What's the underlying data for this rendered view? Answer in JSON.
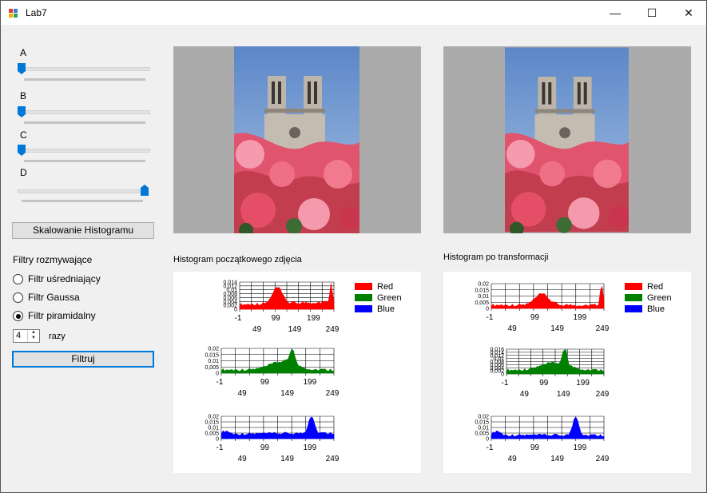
{
  "window": {
    "title": "Lab7",
    "minimize_glyph": "—",
    "maximize_glyph": "☐",
    "close_glyph": "✕"
  },
  "sliders": [
    {
      "label": "A",
      "value_fraction": 0.0
    },
    {
      "label": "B",
      "value_fraction": 0.0
    },
    {
      "label": "C",
      "value_fraction": 0.0
    },
    {
      "label": "D",
      "value_fraction": 1.0
    }
  ],
  "scale_button": "Skalowanie Histogramu",
  "filters": {
    "group_label": "Filtry rozmywające",
    "options": [
      {
        "label": "Filtr uśredniający",
        "checked": false
      },
      {
        "label": "Filtr Gaussa",
        "checked": false
      },
      {
        "label": "Filtr piramidalny",
        "checked": true
      }
    ],
    "times_value": "4",
    "times_label": "razy",
    "apply_button": "Filtruj"
  },
  "histograms": {
    "left_title": "Histogram początkowego zdjęcia",
    "right_title": "Histogram po transformacji",
    "legend": [
      {
        "name": "Red",
        "color": "#ff0000"
      },
      {
        "name": "Green",
        "color": "#008000"
      },
      {
        "name": "Blue",
        "color": "#0000ff"
      }
    ],
    "x_ticks_top": [
      "-1",
      "99",
      "199"
    ],
    "x_ticks_bottom": [
      "49",
      "149",
      "249"
    ]
  },
  "chart_data": [
    {
      "type": "area",
      "panel": "original",
      "series": [
        {
          "name": "Red",
          "color": "#ff0000"
        }
      ],
      "y_ticks": [
        "0",
        "0,002",
        "0,004",
        "0,006",
        "0,008",
        "0,01",
        "0,012",
        "0,014"
      ]
    },
    {
      "type": "area",
      "panel": "original",
      "series": [
        {
          "name": "Green",
          "color": "#008000"
        }
      ],
      "y_ticks": [
        "0",
        "0,005",
        "0,01",
        "0,015",
        "0,02"
      ]
    },
    {
      "type": "area",
      "panel": "original",
      "series": [
        {
          "name": "Blue",
          "color": "#0000ff"
        }
      ],
      "y_ticks": [
        "0",
        "0,005",
        "0,01",
        "0,015",
        "0,02"
      ]
    },
    {
      "type": "area",
      "panel": "transformed",
      "series": [
        {
          "name": "Red",
          "color": "#ff0000"
        }
      ],
      "y_ticks": [
        "0",
        "0,005",
        "0,01",
        "0,015",
        "0,02"
      ]
    },
    {
      "type": "area",
      "panel": "transformed",
      "series": [
        {
          "name": "Green",
          "color": "#008000"
        }
      ],
      "y_ticks": [
        "0",
        "0,002",
        "0,004",
        "0,006",
        "0,008",
        "0,01",
        "0,012",
        "0,014",
        "0,016"
      ]
    },
    {
      "type": "area",
      "panel": "transformed",
      "series": [
        {
          "name": "Blue",
          "color": "#0000ff"
        }
      ],
      "y_ticks": [
        "0",
        "0,005",
        "0,01",
        "0,015",
        "0,02"
      ]
    }
  ]
}
